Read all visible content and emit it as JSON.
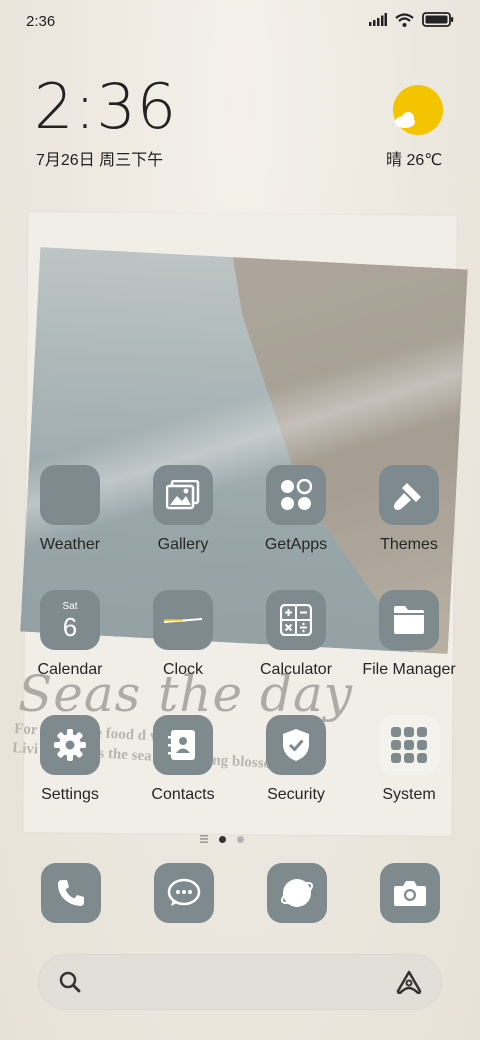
{
  "status_bar": {
    "time": "2:36"
  },
  "clock_widget": {
    "time": "2:36",
    "date": "7月26日 周三下午"
  },
  "weather_widget": {
    "condition_temp": "晴 26℃"
  },
  "wallpaper": {
    "script_title": "Seas the day",
    "poem_line_1": "For    row on    re food    d vegeable",
    "poem_line_2": "Livi   house to   s the sea with spring blosso"
  },
  "apps": [
    {
      "label": "Weather"
    },
    {
      "label": "Gallery"
    },
    {
      "label": "GetApps"
    },
    {
      "label": "Themes"
    },
    {
      "label": "Calendar",
      "day_name": "Sat",
      "day_number": "6"
    },
    {
      "label": "Clock"
    },
    {
      "label": "Calculator"
    },
    {
      "label": "File Manager"
    },
    {
      "label": "Settings"
    },
    {
      "label": "Contacts"
    },
    {
      "label": "Security"
    },
    {
      "label": "System"
    }
  ],
  "page_indicator": {
    "count": 2,
    "active_index": 0
  },
  "dock": [
    "phone-icon",
    "messages-icon",
    "browser-icon",
    "camera-icon"
  ],
  "colors": {
    "icon_bg": "#7f8a8f",
    "sun": "#f5c400",
    "search_bg": "#e2dfd8"
  }
}
